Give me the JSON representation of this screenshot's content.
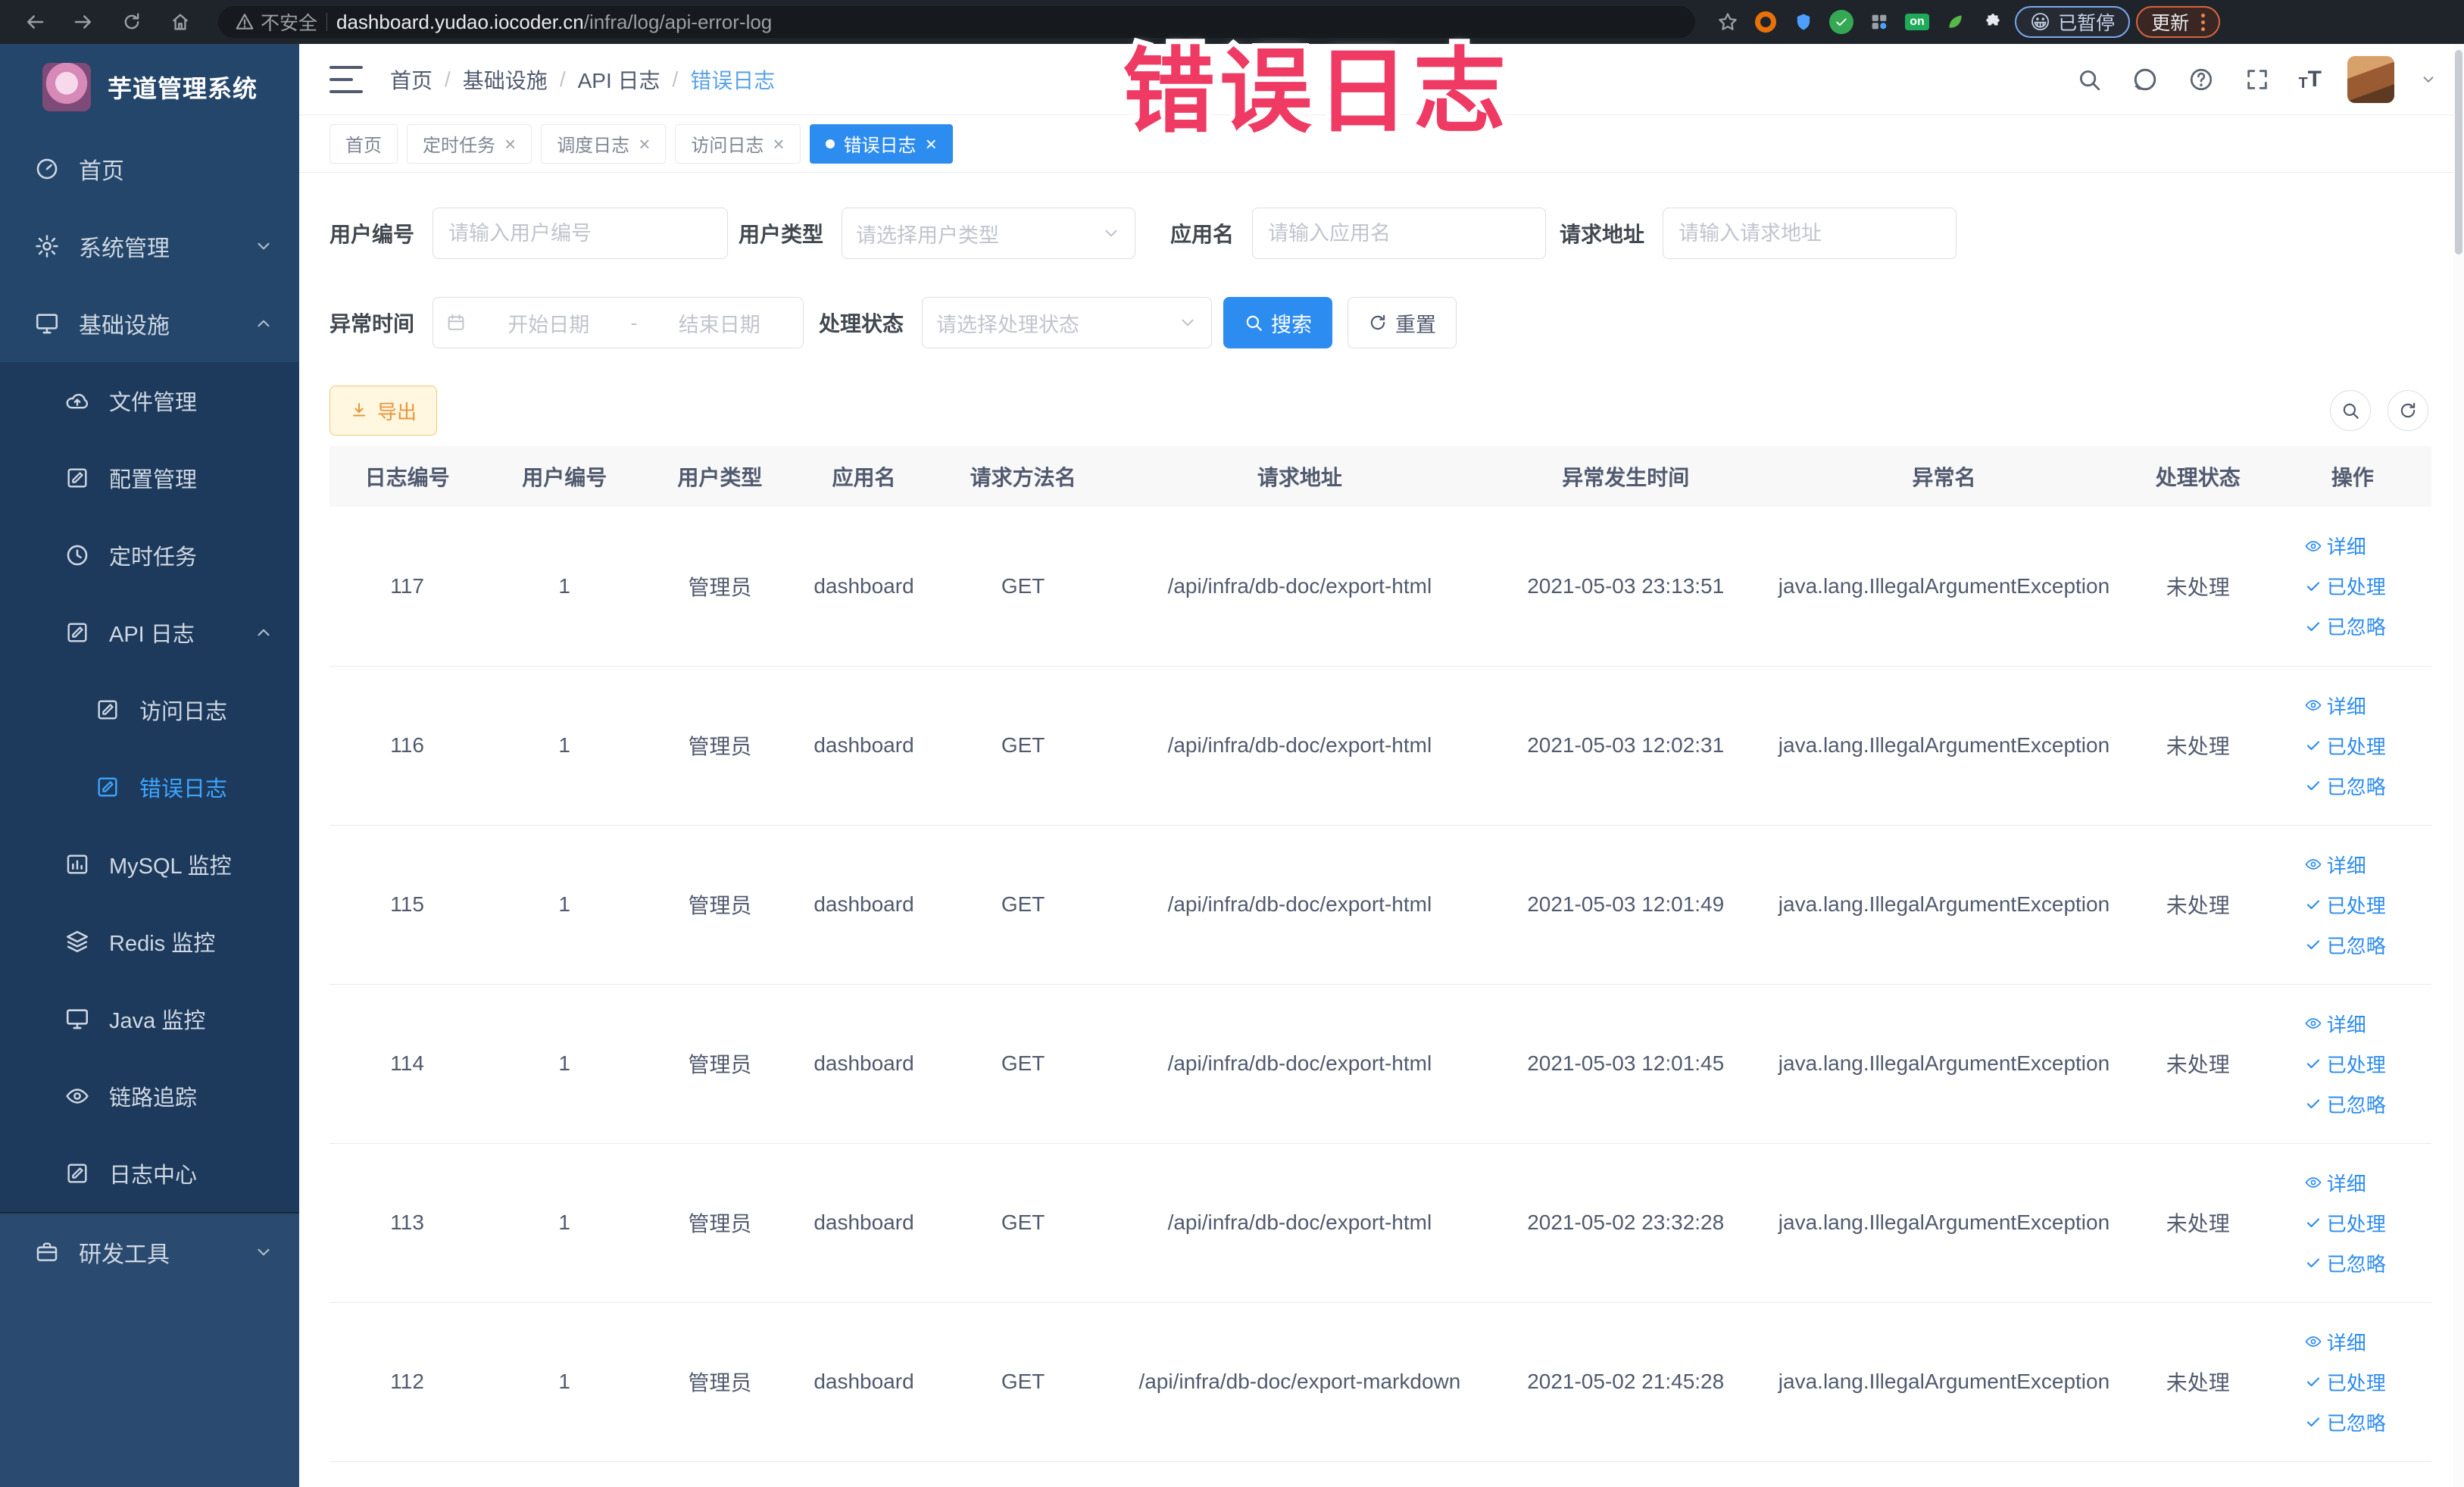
{
  "overlay": {
    "text": "错误日志"
  },
  "browser": {
    "security_label": "不安全",
    "url_domain": "dashboard.yudao.iocoder.cn",
    "url_path": "/infra/log/api-error-log",
    "paused_badge": "已暂停",
    "update_button": "更新"
  },
  "app": {
    "title": "芋道管理系统"
  },
  "breadcrumb": {
    "separator": "/",
    "items": [
      "首页",
      "基础设施",
      "API 日志",
      "错误日志"
    ]
  },
  "tags": [
    {
      "label": "首页"
    },
    {
      "label": "定时任务"
    },
    {
      "label": "调度日志"
    },
    {
      "label": "访问日志"
    },
    {
      "label": "错误日志"
    }
  ],
  "sidebar": {
    "items": [
      {
        "label": "首页"
      },
      {
        "label": "系统管理"
      },
      {
        "label": "基础设施"
      },
      {
        "label": "文件管理"
      },
      {
        "label": "配置管理"
      },
      {
        "label": "定时任务"
      },
      {
        "label": "API 日志"
      },
      {
        "label": "访问日志"
      },
      {
        "label": "错误日志"
      },
      {
        "label": "MySQL 监控"
      },
      {
        "label": "Redis 监控"
      },
      {
        "label": "Java 监控"
      },
      {
        "label": "链路追踪"
      },
      {
        "label": "日志中心"
      },
      {
        "label": "研发工具"
      }
    ]
  },
  "filters": {
    "user_id_label": "用户编号",
    "user_id_placeholder": "请输入用户编号",
    "user_type_label": "用户类型",
    "user_type_placeholder": "请选择用户类型",
    "app_name_label": "应用名",
    "app_name_placeholder": "请输入应用名",
    "request_url_label": "请求地址",
    "request_url_placeholder": "请输入请求地址",
    "exception_time_label": "异常时间",
    "date_start_placeholder": "开始日期",
    "date_separator": "-",
    "date_end_placeholder": "结束日期",
    "process_status_label": "处理状态",
    "process_status_placeholder": "请选择处理状态",
    "search_button": "搜索",
    "reset_button": "重置"
  },
  "toolbar": {
    "export_button": "导出"
  },
  "table": {
    "columns": [
      "日志编号",
      "用户编号",
      "用户类型",
      "应用名",
      "请求方法名",
      "请求地址",
      "异常发生时间",
      "异常名",
      "处理状态",
      "操作"
    ],
    "row_actions": [
      "详细",
      "已处理",
      "已忽略"
    ],
    "rows": [
      {
        "id": "117",
        "user_id": "1",
        "user_type": "管理员",
        "app_name": "dashboard",
        "method": "GET",
        "url": "/api/infra/db-doc/export-html",
        "time": "2021-05-03 23:13:51",
        "exception": "java.lang.IllegalArgumentException",
        "status": "未处理"
      },
      {
        "id": "116",
        "user_id": "1",
        "user_type": "管理员",
        "app_name": "dashboard",
        "method": "GET",
        "url": "/api/infra/db-doc/export-html",
        "time": "2021-05-03 12:02:31",
        "exception": "java.lang.IllegalArgumentException",
        "status": "未处理"
      },
      {
        "id": "115",
        "user_id": "1",
        "user_type": "管理员",
        "app_name": "dashboard",
        "method": "GET",
        "url": "/api/infra/db-doc/export-html",
        "time": "2021-05-03 12:01:49",
        "exception": "java.lang.IllegalArgumentException",
        "status": "未处理"
      },
      {
        "id": "114",
        "user_id": "1",
        "user_type": "管理员",
        "app_name": "dashboard",
        "method": "GET",
        "url": "/api/infra/db-doc/export-html",
        "time": "2021-05-03 12:01:45",
        "exception": "java.lang.IllegalArgumentException",
        "status": "未处理"
      },
      {
        "id": "113",
        "user_id": "1",
        "user_type": "管理员",
        "app_name": "dashboard",
        "method": "GET",
        "url": "/api/infra/db-doc/export-html",
        "time": "2021-05-02 23:32:28",
        "exception": "java.lang.IllegalArgumentException",
        "status": "未处理"
      },
      {
        "id": "112",
        "user_id": "1",
        "user_type": "管理员",
        "app_name": "dashboard",
        "method": "GET",
        "url": "/api/infra/db-doc/export-markdown",
        "time": "2021-05-02 21:45:28",
        "exception": "java.lang.IllegalArgumentException",
        "status": "未处理"
      }
    ]
  },
  "colors": {
    "primary": "#2d8cf0",
    "sidebar": "#24466b",
    "sidebar_sub": "#1d3a5c",
    "active_menu": "#3ea6ff",
    "warning_text": "#e9953b",
    "overlay_pink": "#ef3a63"
  }
}
